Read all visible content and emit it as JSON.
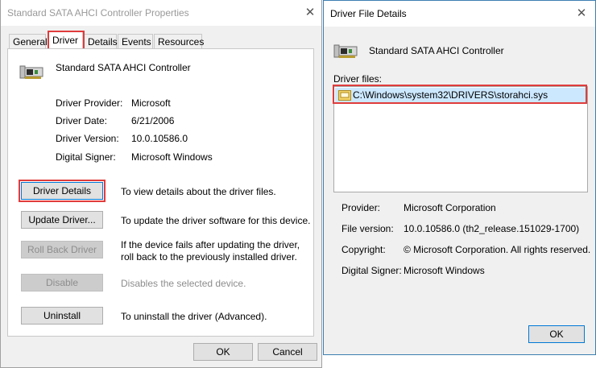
{
  "properties_dialog": {
    "title": "Standard SATA AHCI Controller Properties",
    "tabs": [
      "General",
      "Driver",
      "Details",
      "Events",
      "Resources"
    ],
    "active_tab": "Driver",
    "device_name": "Standard SATA AHCI Controller",
    "fields": [
      {
        "label": "Driver Provider:",
        "value": "Microsoft"
      },
      {
        "label": "Driver Date:",
        "value": "6/21/2006"
      },
      {
        "label": "Driver Version:",
        "value": "10.0.10586.0"
      },
      {
        "label": "Digital Signer:",
        "value": "Microsoft Windows"
      }
    ],
    "actions": [
      {
        "button": "Driver Details",
        "description": "To view details about the driver files."
      },
      {
        "button": "Update Driver...",
        "description": "To update the driver software for this device."
      },
      {
        "button": "Roll Back Driver",
        "description": "If the device fails after updating the driver, roll back to the previously installed driver."
      },
      {
        "button": "Disable",
        "description": "Disables the selected device."
      },
      {
        "button": "Uninstall",
        "description": "To uninstall the driver (Advanced)."
      }
    ],
    "ok_label": "OK",
    "cancel_label": "Cancel"
  },
  "details_dialog": {
    "title": "Driver File Details",
    "device_name": "Standard SATA AHCI Controller",
    "files_label": "Driver files:",
    "files": [
      "C:\\Windows\\system32\\DRIVERS\\storahci.sys"
    ],
    "fields": [
      {
        "label": "Provider:",
        "value": "Microsoft Corporation"
      },
      {
        "label": "File version:",
        "value": "10.0.10586.0 (th2_release.151029-1700)"
      },
      {
        "label": "Copyright:",
        "value": "© Microsoft Corporation. All rights reserved."
      },
      {
        "label": "Digital Signer:",
        "value": "Microsoft Windows"
      }
    ],
    "ok_label": "OK"
  },
  "icons": {
    "close": "close-icon",
    "device": "storage-controller-icon",
    "file": "system-file-icon"
  },
  "colors": {
    "highlight_box": "#e03c3c",
    "selection": "#cce8ff",
    "focus_border": "#0078d7"
  }
}
